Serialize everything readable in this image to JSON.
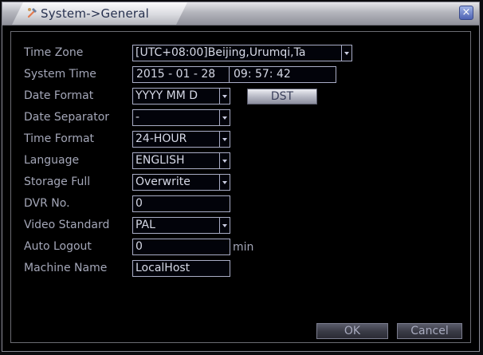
{
  "window": {
    "title": "System->General",
    "close_icon": "close-icon"
  },
  "fields": {
    "time_zone": {
      "label": "Time Zone",
      "value": "[UTC+08:00]Beijing,Urumqi,Ta"
    },
    "system_time": {
      "label": "System Time",
      "date": "2015 - 01 - 28",
      "time": "09: 57: 42"
    },
    "date_format": {
      "label": "Date Format",
      "value": "YYYY MM D"
    },
    "date_separator": {
      "label": "Date Separator",
      "value": "-"
    },
    "time_format": {
      "label": "Time Format",
      "value": "24-HOUR"
    },
    "language": {
      "label": "Language",
      "value": "ENGLISH"
    },
    "storage_full": {
      "label": "Storage Full",
      "value": "Overwrite"
    },
    "dvr_no": {
      "label": "DVR No.",
      "value": "0"
    },
    "video_standard": {
      "label": "Video Standard",
      "value": "PAL"
    },
    "auto_logout": {
      "label": "Auto Logout",
      "value": "0",
      "unit": "min"
    },
    "machine_name": {
      "label": "Machine Name",
      "value": "LocalHost"
    }
  },
  "buttons": {
    "dst": "DST",
    "ok": "OK",
    "cancel": "Cancel"
  },
  "colors": {
    "label": "#a4a7b8",
    "field_border": "#a9adc6",
    "title_bar": "#c8c9cf"
  }
}
